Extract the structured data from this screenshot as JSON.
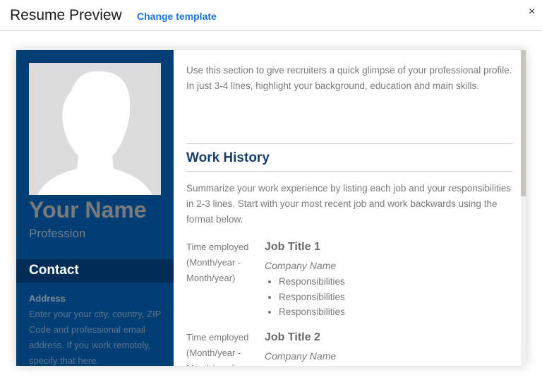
{
  "header": {
    "title": "Resume Preview",
    "change_template": "Change template",
    "close": "×"
  },
  "sidebar": {
    "name": "Your Name",
    "profession": "Profession",
    "contact_heading": "Contact",
    "address_label": "Address",
    "address_text": "Enter your your city, country, ZIP Code and professional email address. If you work remotely, specify that here."
  },
  "main": {
    "summary": "Use this section to give recruiters a quick glimpse of your professional profile. In just 3-4 lines, highlight your background, education and main skills.",
    "work_heading": "Work History",
    "work_intro": "Summarize your work experience by listing each job and your responsibilities in 2-3 lines. Start with your most recent job and work backwards using the format below.",
    "jobs": [
      {
        "time": "Time employed (Month/year - Month/year)",
        "title": "Job Title 1",
        "company": "Company Name",
        "items": [
          "Responsibilities",
          "Responsibilities",
          "Responsibilities"
        ]
      },
      {
        "time": "Time employed (Month/year - Month/year)",
        "title": "Job Title 2",
        "company": "Company Name"
      }
    ]
  }
}
